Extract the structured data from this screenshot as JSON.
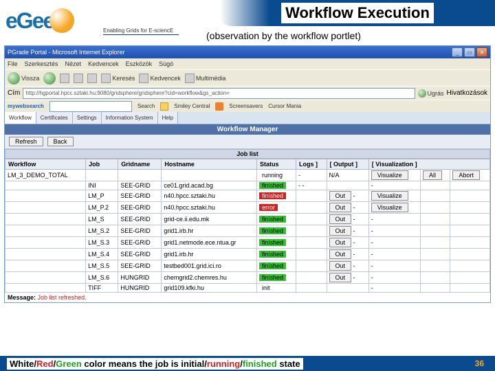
{
  "header": {
    "logo_text": "eGee",
    "tagline": "Enabling Grids for E-sciencE",
    "title": "Workflow Execution",
    "subtitle": "(observation by the workflow portlet)"
  },
  "browser": {
    "window_title": "PGrade Portal - Microsoft Internet Explorer",
    "menu": [
      "File",
      "Szerkesztés",
      "Nézet",
      "Kedvencek",
      "Eszközök",
      "Súgó"
    ],
    "toolbar": {
      "back": "Vissza",
      "search": "Keresés",
      "favorites": "Kedvencek",
      "media": "Multimédia"
    },
    "address_label": "Cím",
    "address": "http://hgportal.hpcc.sztaki.hu:9080/gridsphere/gridsphere?cid=workflow&gs_action=",
    "go": "Ugrás",
    "links": "Hivatkozások",
    "searchweb_brand": "mywebsearch",
    "searchweb": [
      "Search",
      "Smiley Central",
      "Screensavers",
      "Cursor Mania"
    ]
  },
  "portal": {
    "tabs": [
      "Workflow",
      "Certificates",
      "Settings",
      "Information System",
      "Help"
    ],
    "portlet_title": "Workflow Manager",
    "refresh": "Refresh",
    "back": "Back",
    "section": "Job list",
    "message_label": "Message:",
    "message": "Job list refreshed."
  },
  "columns": [
    "Workflow",
    "Job",
    "Gridname",
    "Hostname",
    "Status",
    "Logs ]",
    "[ Output ]",
    "[ Visualization ]"
  ],
  "actions": {
    "visualize": "Visualize",
    "all": "All",
    "abort": "Abort",
    "out": "Out"
  },
  "rows": [
    {
      "workflow": "LM_3_DEMO_TOTAL",
      "job": "",
      "grid": "",
      "host": "",
      "status": "running",
      "status_cls": "st-white",
      "logs": "-",
      "out": "N/A",
      "vis": true,
      "all": true,
      "abort": true
    },
    {
      "workflow": "",
      "job": "INI",
      "grid": "SEE-GRID",
      "host": "ce01.grid.acad.bg",
      "status": "finished",
      "status_cls": "st-green",
      "logs": "- -",
      "out": "",
      "vis": false
    },
    {
      "workflow": "",
      "job": "LM_P",
      "grid": "SEE-GRID",
      "host": "n40.hpcc.sztaki.hu",
      "status": "finished",
      "status_cls": "st-red",
      "logs": "",
      "out": "Out",
      "vis": true
    },
    {
      "workflow": "",
      "job": "LM_P.2",
      "grid": "SEE-GRID",
      "host": "n40.hpcc.sztaki.hu",
      "status": "error",
      "status_cls": "st-red",
      "logs": "",
      "out": "Out",
      "vis": true
    },
    {
      "workflow": "",
      "job": "LM_S",
      "grid": "SEE-GRID",
      "host": "grid-ce.ii.edu.mk",
      "status": "finished",
      "status_cls": "st-green",
      "logs": "",
      "out": "Out",
      "vis": false
    },
    {
      "workflow": "",
      "job": "LM_S.2",
      "grid": "SEE-GRID",
      "host": "grid1.irb.hr",
      "status": "finished",
      "status_cls": "st-green",
      "logs": "",
      "out": "Out",
      "vis": false
    },
    {
      "workflow": "",
      "job": "LM_S.3",
      "grid": "SEE-GRID",
      "host": "grid1.netmode.ece.ntua.gr",
      "status": "finished",
      "status_cls": "st-green",
      "logs": "",
      "out": "Out",
      "vis": false
    },
    {
      "workflow": "",
      "job": "LM_S.4",
      "grid": "SEE-GRID",
      "host": "grid1.irb.hr",
      "status": "finished",
      "status_cls": "st-green",
      "logs": "",
      "out": "Out",
      "vis": false
    },
    {
      "workflow": "",
      "job": "LM_S.5",
      "grid": "SEE-GRID",
      "host": "testbed001.grid.ici.ro",
      "status": "finished",
      "status_cls": "st-green",
      "logs": "",
      "out": "Out",
      "vis": false
    },
    {
      "workflow": "",
      "job": "LM_S.6",
      "grid": "HUNGRID",
      "host": "chemgrid2.chemres.hu",
      "status": "finished",
      "status_cls": "st-green",
      "logs": "",
      "out": "Out",
      "vis": false
    },
    {
      "workflow": "",
      "job": "TIFF",
      "grid": "HUNGRID",
      "host": "grid109.kfki.hu",
      "status": "init",
      "status_cls": "st-white",
      "logs": "",
      "out": "",
      "vis": false
    }
  ],
  "footer": {
    "parts": [
      "White",
      "/",
      "Red",
      "/",
      "Green",
      " color means the job is ",
      "initial",
      "/",
      "running",
      "/",
      "finished",
      " state"
    ],
    "classes": [
      "c-white",
      "",
      "c-red",
      "",
      "c-green",
      "",
      "c-white",
      "",
      "c-red",
      "",
      "c-green",
      ""
    ]
  },
  "page_number": "36"
}
